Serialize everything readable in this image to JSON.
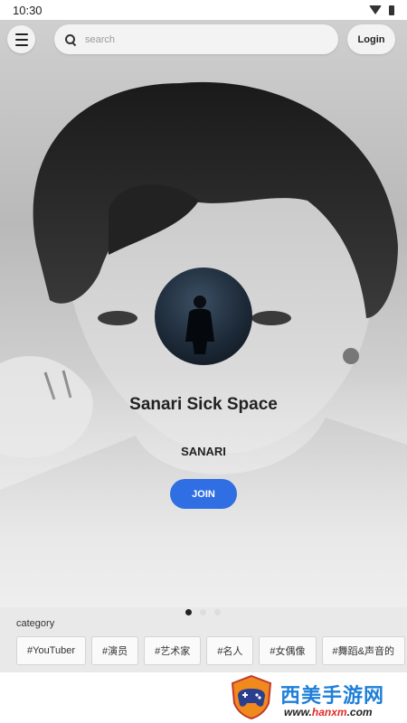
{
  "status_bar": {
    "time": "10:30",
    "wifi_icon": "wifi-icon",
    "battery_icon": "battery-icon"
  },
  "header": {
    "menu_icon": "hamburger-icon",
    "search_placeholder": "search",
    "search_icon": "search-icon",
    "login_label": "Login"
  },
  "profile": {
    "space_title": "Sanari Sick Space",
    "owner_name": "SANARI",
    "join_label": "JOIN"
  },
  "pager": {
    "pages": 3,
    "active_index": 0
  },
  "category": {
    "label": "category",
    "chips": [
      "#YouTuber",
      "#演员",
      "#艺术家",
      "#名人",
      "#女偶像",
      "#舞蹈&声音的"
    ]
  },
  "watermark": {
    "title": "西美手游网",
    "url_prefix": "www.",
    "url_main": "hanxm",
    "url_suffix": ".com"
  },
  "colors": {
    "accent": "#2f6fe3",
    "watermark_blue": "#1e7fd8",
    "watermark_red": "#e02a2a"
  }
}
